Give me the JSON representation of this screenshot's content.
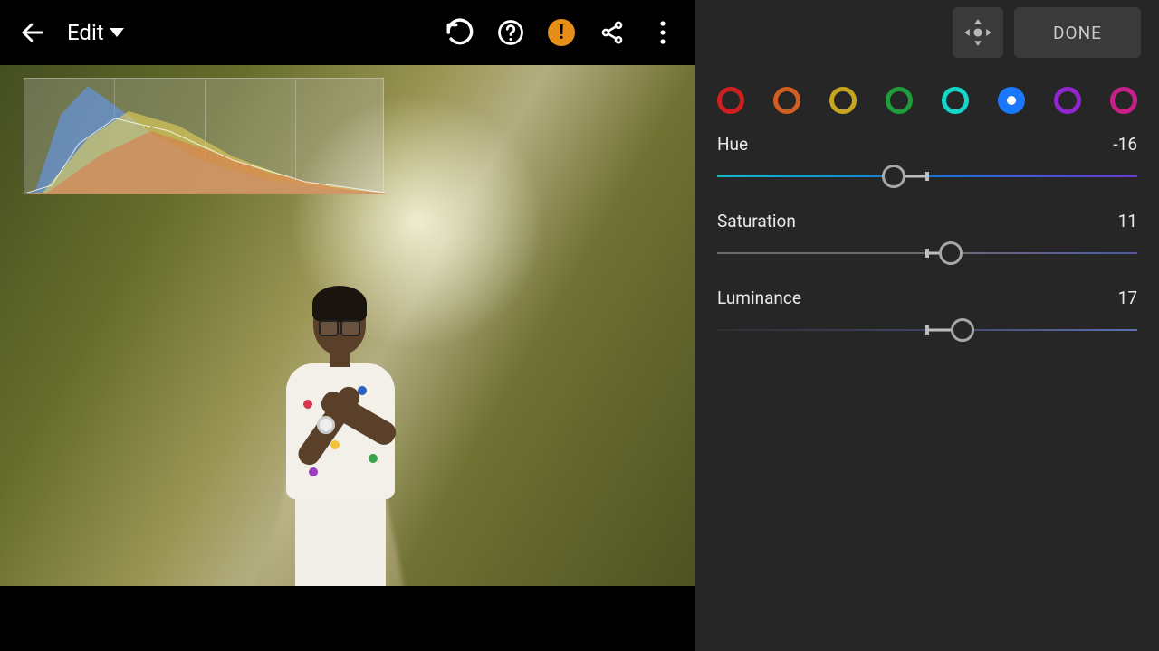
{
  "header": {
    "title": "Edit",
    "done_label": "DONE"
  },
  "color_swatches": [
    {
      "name": "red",
      "color": "#d11f1f",
      "selected": false
    },
    {
      "name": "orange",
      "color": "#d45e1f",
      "selected": false
    },
    {
      "name": "yellow",
      "color": "#c7a51f",
      "selected": false
    },
    {
      "name": "green",
      "color": "#1f9d3a",
      "selected": false
    },
    {
      "name": "aqua",
      "color": "#14d6c8",
      "selected": false
    },
    {
      "name": "blue",
      "color": "#1a78ff",
      "selected": true
    },
    {
      "name": "purple",
      "color": "#9126d1",
      "selected": false
    },
    {
      "name": "magenta",
      "color": "#c81f8b",
      "selected": false
    }
  ],
  "sliders": {
    "hue": {
      "label": "Hue",
      "value": -16,
      "min": -100,
      "max": 100,
      "track": "gradient-hue"
    },
    "saturation": {
      "label": "Saturation",
      "value": 11,
      "min": -100,
      "max": 100,
      "track": "gray-to-blue"
    },
    "luminance": {
      "label": "Luminance",
      "value": 17,
      "min": -100,
      "max": 100,
      "track": "dark-to-blue"
    }
  },
  "icons": {
    "back": "←",
    "undo": "↶",
    "help": "?",
    "warning": "!",
    "share": "share",
    "menu": "⋮",
    "move": "✥",
    "dropdown": "▼"
  }
}
